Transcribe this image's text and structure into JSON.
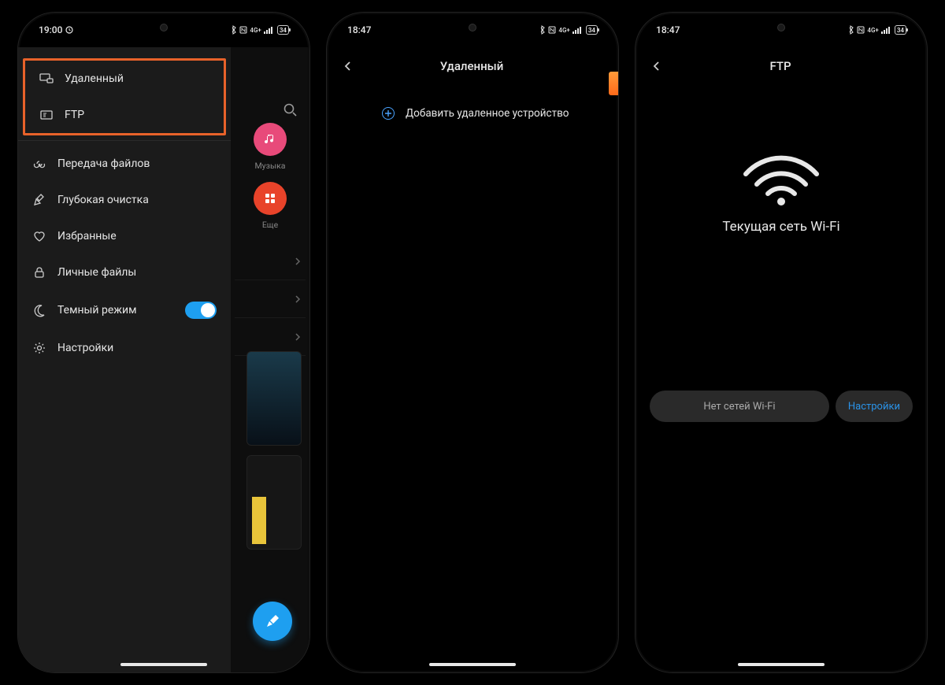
{
  "phone1": {
    "status": {
      "time": "19:00",
      "battery": "34"
    },
    "tiles": {
      "music": "Музыка",
      "more": "Еще"
    },
    "drawer": {
      "remote": "Удаленный",
      "ftp": "FTP",
      "transfer": "Передача файлов",
      "cleanup": "Глубокая очистка",
      "favorites": "Избранные",
      "private": "Личные файлы",
      "darkmode": "Темный режим",
      "settings": "Настройки"
    }
  },
  "phone2": {
    "status": {
      "time": "18:47",
      "battery": "34"
    },
    "title": "Удаленный",
    "add_remote": "Добавить удаленное устройство"
  },
  "phone3": {
    "status": {
      "time": "18:47",
      "battery": "34"
    },
    "title": "FTP",
    "current_network": "Текущая сеть Wi-Fi",
    "no_wifi": "Нет сетей Wi-Fi",
    "settings": "Настройки"
  },
  "signal_label": "4G+"
}
